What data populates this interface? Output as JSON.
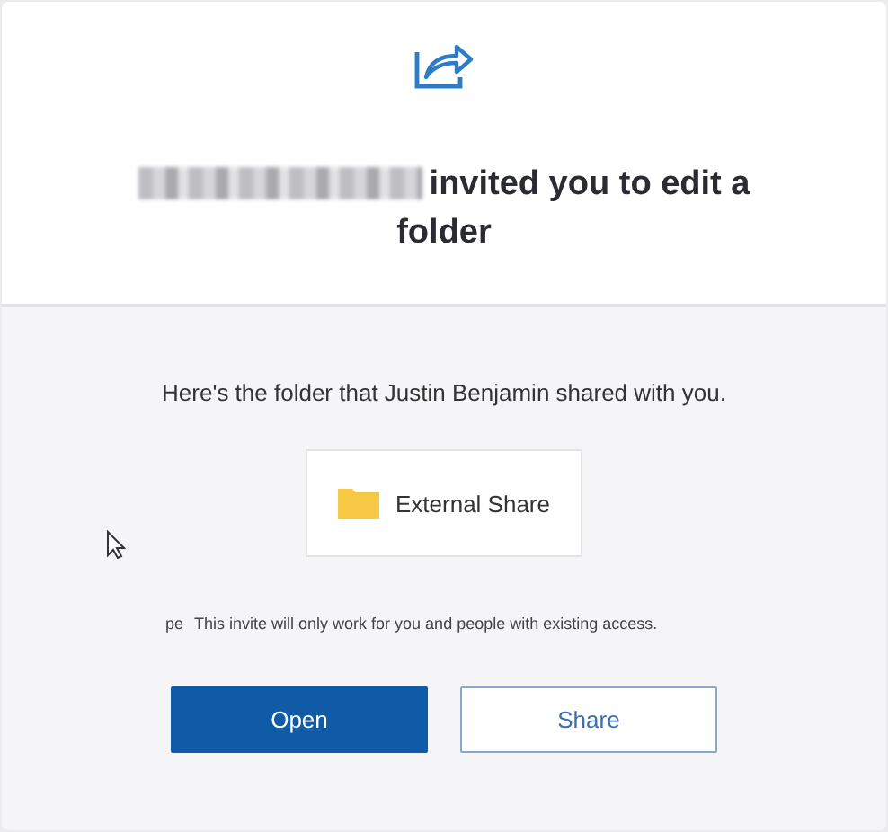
{
  "header": {
    "heading": "invited you to edit a folder"
  },
  "body": {
    "message": "Here's the folder that Justin Benjamin shared with you.",
    "folder": {
      "name": "External Share"
    },
    "note_prefix": "pe",
    "note": "This invite will only work for you and people with existing access.",
    "buttons": [
      {
        "label": "Open",
        "kind": "primary"
      },
      {
        "label": "Share",
        "kind": "secondary"
      }
    ]
  }
}
